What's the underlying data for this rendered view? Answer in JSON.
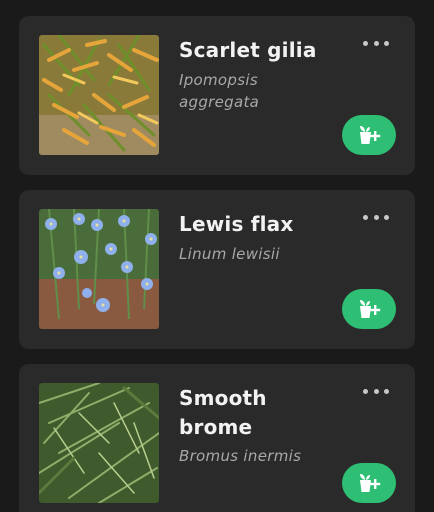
{
  "plants": [
    {
      "common_name": "Scarlet gilia",
      "scientific_name": "Ipomopsis aggregata",
      "image": "scarlet-gilia-photo"
    },
    {
      "common_name": "Lewis flax",
      "scientific_name": "Linum lewisii",
      "image": "lewis-flax-photo"
    },
    {
      "common_name": "Smooth brome",
      "scientific_name": "Bromus inermis",
      "image": "smooth-brome-photo"
    }
  ],
  "icons": {
    "more": "more-options-icon",
    "add": "add-to-garden-icon"
  },
  "colors": {
    "background": "#1a1a1a",
    "card": "#2a2a2a",
    "accent": "#2fbf74",
    "title": "#f2f2f2",
    "subtitle": "#a8a8a8"
  }
}
